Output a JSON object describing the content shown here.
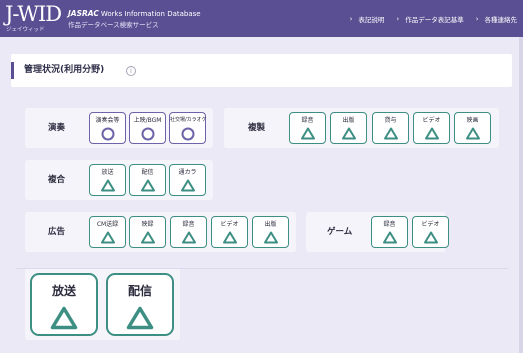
{
  "header": {
    "logo_text": "J-WID",
    "logo_sub": "ジェイウィッド",
    "brand_bold": "JASRAC",
    "brand_line1": "Works Information Database",
    "brand_line2": "作品データベース検索サービス",
    "nav": [
      "表記説明",
      "作品データ表記基準",
      "各種連絡先"
    ],
    "color": "#5a4f93"
  },
  "main": {
    "title": "管理状況(利用分野)",
    "info_icon": "info-icon",
    "groups": [
      {
        "label": "演奏",
        "items": [
          {
            "label": "演奏会等",
            "mark": "circle",
            "color": "purple"
          },
          {
            "label": "上映/BGM",
            "mark": "circle",
            "color": "purple"
          },
          {
            "label": "社交場/カラオケ",
            "mark": "circle",
            "color": "purple"
          }
        ]
      },
      {
        "label": "複製",
        "items": [
          {
            "label": "録音",
            "mark": "triangle",
            "color": "green"
          },
          {
            "label": "出版",
            "mark": "triangle",
            "color": "green"
          },
          {
            "label": "貸与",
            "mark": "triangle",
            "color": "green"
          },
          {
            "label": "ビデオ",
            "mark": "triangle",
            "color": "green"
          },
          {
            "label": "映画",
            "mark": "triangle",
            "color": "green"
          }
        ]
      },
      {
        "label": "複合",
        "items": [
          {
            "label": "放送",
            "mark": "triangle",
            "color": "green"
          },
          {
            "label": "配信",
            "mark": "triangle",
            "color": "green"
          },
          {
            "label": "通カラ",
            "mark": "triangle",
            "color": "green"
          }
        ]
      },
      {
        "label": "広告",
        "items": [
          {
            "label": "CM送録",
            "mark": "triangle",
            "color": "green"
          },
          {
            "label": "映録",
            "mark": "triangle",
            "color": "green"
          },
          {
            "label": "録音",
            "mark": "triangle",
            "color": "green"
          },
          {
            "label": "ビデオ",
            "mark": "triangle",
            "color": "green"
          },
          {
            "label": "出版",
            "mark": "triangle",
            "color": "green"
          }
        ]
      },
      {
        "label": "ゲーム",
        "items": [
          {
            "label": "録音",
            "mark": "triangle",
            "color": "green"
          },
          {
            "label": "ビデオ",
            "mark": "triangle",
            "color": "green"
          }
        ]
      }
    ],
    "big_items": [
      {
        "label": "放送",
        "mark": "triangle"
      },
      {
        "label": "配信",
        "mark": "triangle"
      }
    ]
  },
  "colors": {
    "accent": "#5a4f93",
    "green": "#3e8f83",
    "purple": "#6c63a8",
    "band": "#ebe9f5"
  }
}
